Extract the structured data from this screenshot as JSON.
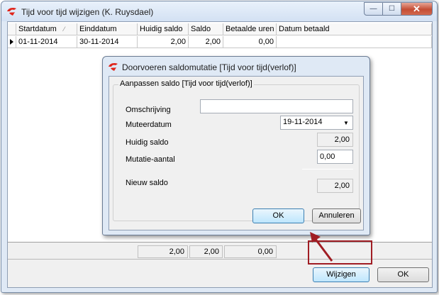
{
  "window": {
    "title": "Tijd voor tijd wijzigen (K. Ruysdael)",
    "controls": {
      "minimize": "—",
      "maximize": "☐",
      "close": "✕"
    }
  },
  "grid": {
    "columns": [
      "Startdatum",
      "Einddatum",
      "Huidig saldo",
      "Saldo",
      "Betaalde uren",
      "Datum betaald"
    ],
    "sort_indicator": "⁄",
    "rows": [
      [
        "01-11-2014",
        "30-11-2014",
        "2,00",
        "2,00",
        "0,00",
        ""
      ]
    ]
  },
  "totals": {
    "huidig_saldo": "2,00",
    "saldo": "2,00",
    "betaalde_uren": "0,00"
  },
  "buttons": {
    "wijzigen": "Wijzigen",
    "ok": "OK"
  },
  "dialog": {
    "title": "Doorvoeren saldomutatie [Tijd voor tijd(verlof)]",
    "group_title": "Aanpassen saldo [Tijd voor tijd(verlof)]",
    "labels": {
      "omschrijving": "Omschrijving",
      "muteerdatum": "Muteerdatum",
      "huidig_saldo": "Huidig saldo",
      "mutatie_aantal": "Mutatie-aantal",
      "nieuw_saldo": "Nieuw saldo"
    },
    "values": {
      "omschrijving": "",
      "muteerdatum": "19-11-2014",
      "huidig_saldo": "2,00",
      "mutatie_aantal": "0,00",
      "nieuw_saldo": "2,00"
    },
    "buttons": {
      "ok": "OK",
      "annuleren": "Annuleren"
    }
  },
  "colors": {
    "annotation": "#a01d24",
    "logo": "#e0251b"
  }
}
